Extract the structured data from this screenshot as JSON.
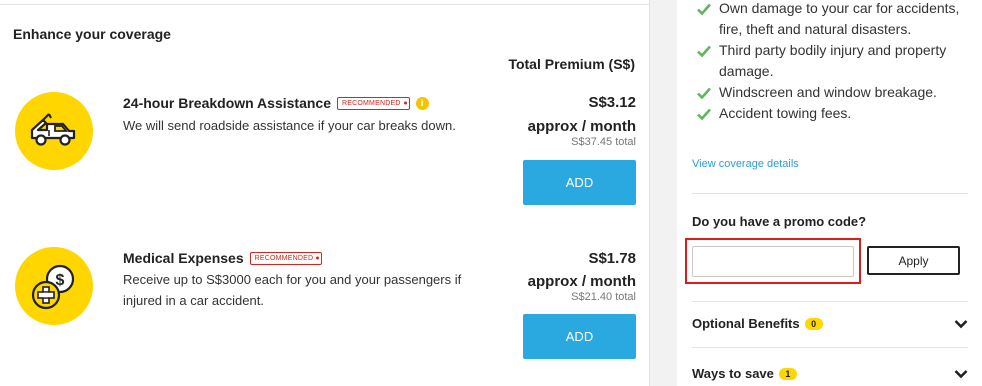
{
  "enhance": {
    "title": "Enhance your coverage",
    "premium_header": "Total Premium (S$)",
    "addons": [
      {
        "name": "24-hour Breakdown Assistance",
        "badge": "RECOMMENDED",
        "info": "i",
        "description": "We will send roadside assistance if your car breaks down.",
        "price": "S$3.12",
        "period": "approx / month",
        "total": "S$37.45 total",
        "button": "ADD",
        "icon": "tow-truck-icon"
      },
      {
        "name": "Medical Expenses",
        "badge": "RECOMMENDED",
        "description": "Receive up to S$3000 each for you and your passengers if injured in a car accident.",
        "price": "S$1.78",
        "period": "approx / month",
        "total": "S$21.40 total",
        "button": "ADD",
        "icon": "medical-coins-icon"
      }
    ]
  },
  "sidebar": {
    "coverage_items": [
      "Own damage to your car for accidents, fire, theft and natural disasters.",
      "Third party bodily injury and property damage.",
      "Windscreen and window breakage.",
      "Accident towing fees."
    ],
    "view_details": "View coverage details",
    "promo": {
      "question": "Do you have a promo code?",
      "value": "",
      "placeholder": "",
      "apply_label": "Apply"
    },
    "optional_benefits": {
      "label": "Optional Benefits",
      "count": "0"
    },
    "ways_to_save": {
      "label": "Ways to save",
      "count": "1"
    }
  },
  "colors": {
    "accent_yellow": "#ffd600",
    "add_button": "#2aa9e0",
    "check_green": "#5cb85c",
    "recommended_red": "#d9241c",
    "highlight_red": "#e01b1b",
    "link_blue": "#2a9fd6"
  }
}
